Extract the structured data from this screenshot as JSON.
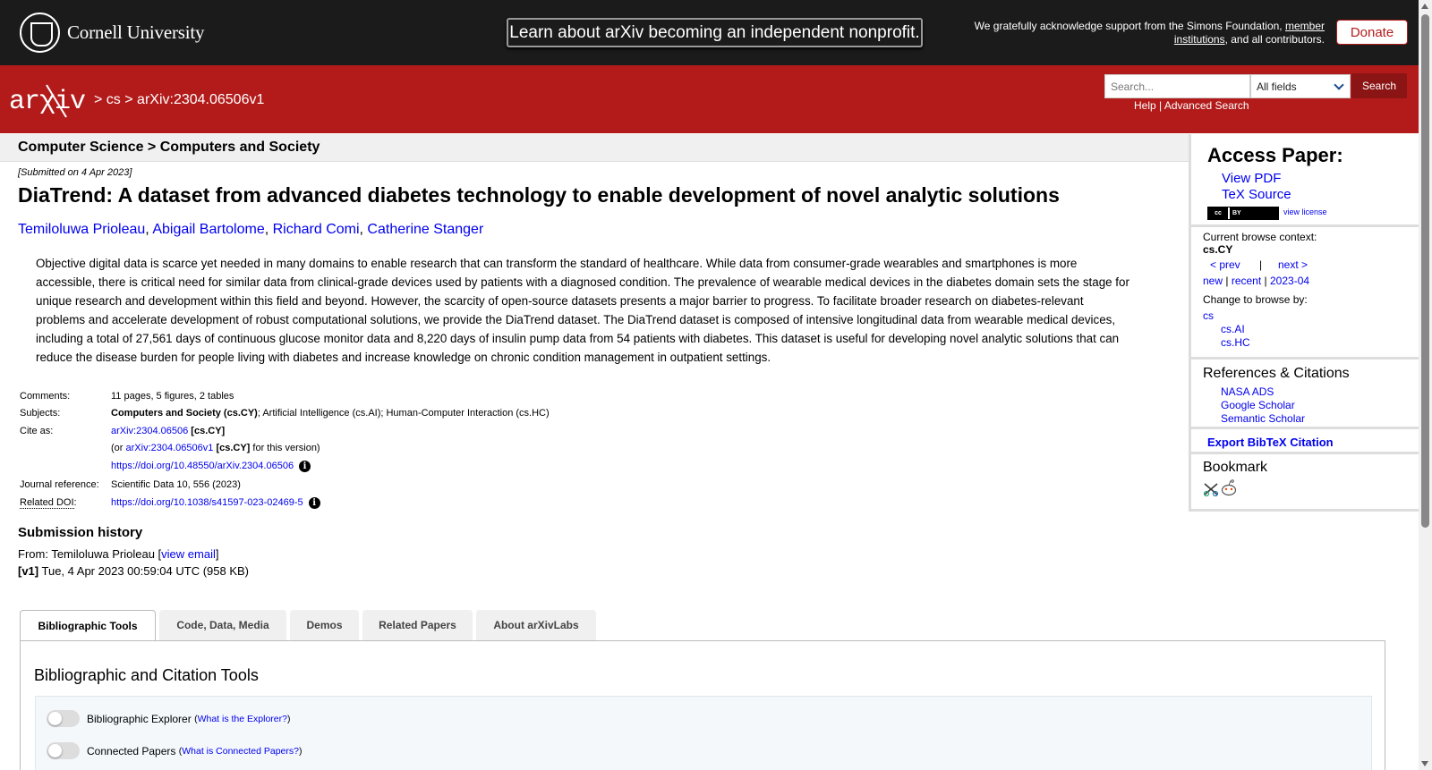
{
  "top": {
    "institution": "Cornell University",
    "banner": "Learn about arXiv becoming an independent nonprofit.",
    "support_prefix": "We gratefully acknowledge support from the Simons Foundation,",
    "support_link": "member institutions",
    "support_suffix": ", and all contributors.",
    "donate": "Donate"
  },
  "header": {
    "logo": "arXiv",
    "crumb_sep1": ">",
    "crumb_cs": "cs",
    "crumb_sep2": ">",
    "crumb_id": "arXiv:2304.06506v1",
    "search_placeholder": "Search...",
    "search_field": "All fields",
    "search_button": "Search",
    "help": "Help",
    "help_sep": "|",
    "advanced": "Advanced Search"
  },
  "subject_heading": "Computer Science > Computers and Society",
  "paper": {
    "submitted": "[Submitted on 4 Apr 2023]",
    "title": "DiaTrend: A dataset from advanced diabetes technology to enable development of novel analytic solutions",
    "authors": [
      "Temiloluwa Prioleau",
      "Abigail Bartolome",
      "Richard Comi",
      "Catherine Stanger"
    ],
    "abstract_lines": [
      "Objective digital data is scarce yet needed in many domains to enable research that can transform the standard of healthcare. While data from consumer-grade wearables and smartphones is more",
      "accessible, there is critical need for similar data from clinical-grade devices used by patients with a diagnosed condition. The prevalence of wearable medical devices in the diabetes domain sets the stage for",
      "unique research and development within this field and beyond. However, the scarcity of open-source datasets presents a major barrier to progress. To facilitate broader research on diabetes-relevant",
      "problems and accelerate development of robust computational solutions, we provide the DiaTrend dataset. The DiaTrend dataset is composed of intensive longitudinal data from wearable medical devices,",
      "including a total of 27,561 days of continuous glucose monitor data and 8,220 days of insulin pump data from 54 patients with diabetes. This dataset is useful for developing novel analytic solutions that can",
      "reduce the disease burden for people living with diabetes and increase knowledge on chronic condition management in outpatient settings."
    ]
  },
  "meta": {
    "comments_label": "Comments:",
    "comments": "11 pages, 5 figures, 2 tables",
    "subjects_label": "Subjects:",
    "subjects_primary": "Computers and Society (cs.CY)",
    "subjects_rest": "; Artificial Intelligence (cs.AI); Human-Computer Interaction (cs.HC)",
    "cite_label": "Cite as:",
    "cite_id": "arXiv:2304.06506",
    "cite_cat": "[cs.CY]",
    "cite_or": "(or",
    "cite_version": "arXiv:2304.06506v1",
    "cite_version_cat": "[cs.CY]",
    "cite_version_suffix": "for this version)",
    "cite_doi": "https://doi.org/10.48550/arXiv.2304.06506",
    "journal_label": "Journal reference:",
    "journal": "Scientific Data 10, 556 (2023)",
    "related_label": "Related DOI",
    "related_colon": ":",
    "related_doi": "https://doi.org/10.1038/s41597-023-02469-5",
    "info_glyph": "i"
  },
  "history": {
    "heading": "Submission history",
    "from_prefix": "From: Temiloluwa Prioleau [",
    "view_email": "view email",
    "from_suffix": "]",
    "v1_label": "[v1]",
    "v1_text": "Tue, 4 Apr 2023 00:59:04 UTC (958 KB)"
  },
  "tabs": [
    "Bibliographic Tools",
    "Code, Data, Media",
    "Demos",
    "Related Papers",
    "About arXivLabs"
  ],
  "tools": {
    "title": "Bibliographic and Citation Tools",
    "explorer": "Bibliographic Explorer",
    "explorer_link": "What is the Explorer?",
    "connected": "Connected Papers",
    "connected_link": "What is Connected Papers?",
    "open_paren": "(",
    "close_paren": ")"
  },
  "sidebar": {
    "access_heading": "Access Paper:",
    "view_pdf": "View PDF",
    "tex_source": "TeX Source",
    "license_cc": "cc",
    "license_by": "BY",
    "view_license": "view license",
    "context_label": "Current browse context:",
    "context": "cs.CY",
    "prev": "< prev",
    "pipe": "|",
    "next": "next >",
    "new": "new",
    "recent": "recent",
    "month": "2023-04",
    "change_label": "Change to browse by:",
    "browse": [
      "cs",
      "cs.AI",
      "cs.HC"
    ],
    "refs_heading": "References & Citations",
    "refs": [
      "NASA ADS",
      "Google Scholar",
      "Semantic Scholar"
    ],
    "export": "Export BibTeX Citation",
    "bookmark": "Bookmark"
  }
}
